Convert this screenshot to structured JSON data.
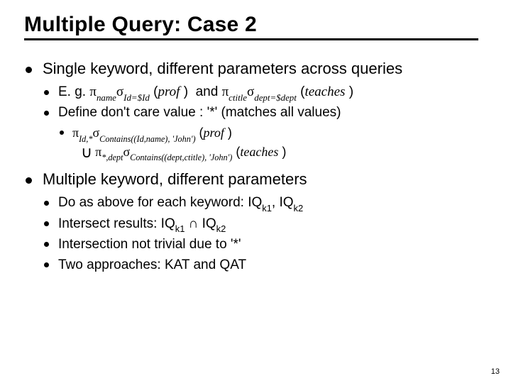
{
  "title": "Multiple Query: Case 2",
  "sections": [
    {
      "text": "Single keyword, different parameters across queries",
      "sub": [
        {
          "html": "E. g. <span class='sym'>π</span><sub><span class='it'>name</span></sub><span class='sym'>σ</span><sub><span class='it'>Id=$Id</span></sub> (<span class='it'>prof</span> )&nbsp; and <span class='sym'>π</span><sub><span class='it'>ctitle</span></sub><span class='sym'>σ</span><sub><span class='it'>dept=$dept</span></sub> (<span class='it'>teaches</span> )"
        },
        {
          "text": "Define don't care value : '*' (matches all values)",
          "sub": [
            {
              "html": "<span class='sym'>π</span><sub><span class='it'>Id,*</span></sub><span class='sym'>σ</span><sub><span class='it'>Contains((Id,name), 'John')</span></sub> (<span class='it'>prof</span> )<span class='line2'><span class='union'>∪</span><span class='sym'>π</span><sub><span class='it'>*,dept</span></sub><span class='sym'>σ</span><sub><span class='it'>Contains((dept,ctitle), 'John')</span></sub> (<span class='it'>teaches</span> )</span>"
            }
          ]
        }
      ]
    },
    {
      "text": "Multiple keyword, different parameters",
      "sub": [
        {
          "html": "Do as above for each keyword: IQ<sub>k1</sub>, IQ<sub>k2</sub>"
        },
        {
          "html": "Intersect results: IQ<sub>k1</sub> ∩ IQ<sub>k2</sub>"
        },
        {
          "text": "Intersection not trivial due to '*'"
        },
        {
          "text": "Two approaches:  KAT and QAT"
        }
      ]
    }
  ],
  "page": "13"
}
